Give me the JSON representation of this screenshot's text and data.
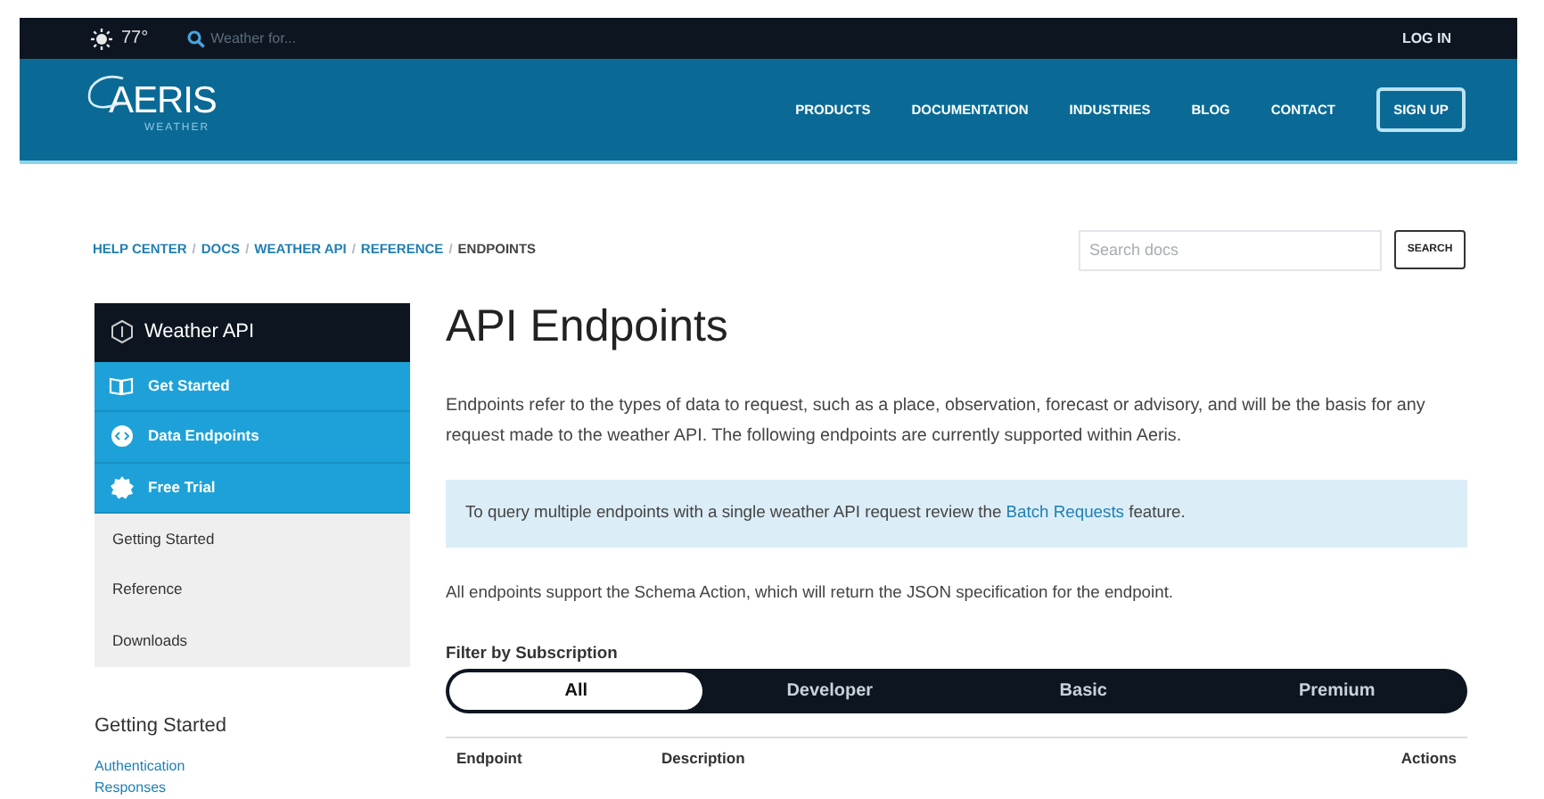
{
  "topbar": {
    "temperature": "77°",
    "search_placeholder": "Weather for...",
    "login": "LOG IN"
  },
  "header": {
    "logo": {
      "name": "AERIS",
      "tagline": "WEATHER"
    },
    "nav": [
      "PRODUCTS",
      "DOCUMENTATION",
      "INDUSTRIES",
      "BLOG",
      "CONTACT"
    ],
    "signup": "SIGN UP"
  },
  "breadcrumb": {
    "separator": "/",
    "items": [
      "HELP CENTER",
      "DOCS",
      "WEATHER API",
      "REFERENCE",
      "ENDPOINTS"
    ]
  },
  "doc_search": {
    "placeholder": "Search docs",
    "button": "SEARCH"
  },
  "sidebar": {
    "title": "Weather API",
    "items": [
      {
        "label": "Get Started",
        "kind": "primary"
      },
      {
        "label": "Data Endpoints",
        "kind": "primary"
      },
      {
        "label": "Free Trial",
        "kind": "primary"
      },
      {
        "label": "Getting Started",
        "kind": "secondary"
      },
      {
        "label": "Reference",
        "kind": "secondary"
      },
      {
        "label": "Downloads",
        "kind": "secondary"
      }
    ],
    "section_title": "Getting Started",
    "links": [
      "Authentication",
      "Responses"
    ]
  },
  "main": {
    "title": "API Endpoints",
    "intro": "Endpoints refer to the types of data to request, such as a place, observation, forecast or advisory, and will be the basis for any request made to the weather API. The following endpoints are currently supported within Aeris.",
    "note": {
      "before": "To query multiple endpoints with a single weather API request review the ",
      "link": "Batch Requests",
      "after": " feature."
    },
    "schema_text": "All endpoints support the Schema Action, which will return the JSON specification for the endpoint.",
    "filter": {
      "label": "Filter by Subscription",
      "options": [
        {
          "label": "All",
          "selected": true
        },
        {
          "label": "Developer",
          "selected": false
        },
        {
          "label": "Basic",
          "selected": false
        },
        {
          "label": "Premium",
          "selected": false
        }
      ]
    },
    "table": {
      "columns": [
        "Endpoint",
        "Description",
        "Actions"
      ]
    }
  }
}
